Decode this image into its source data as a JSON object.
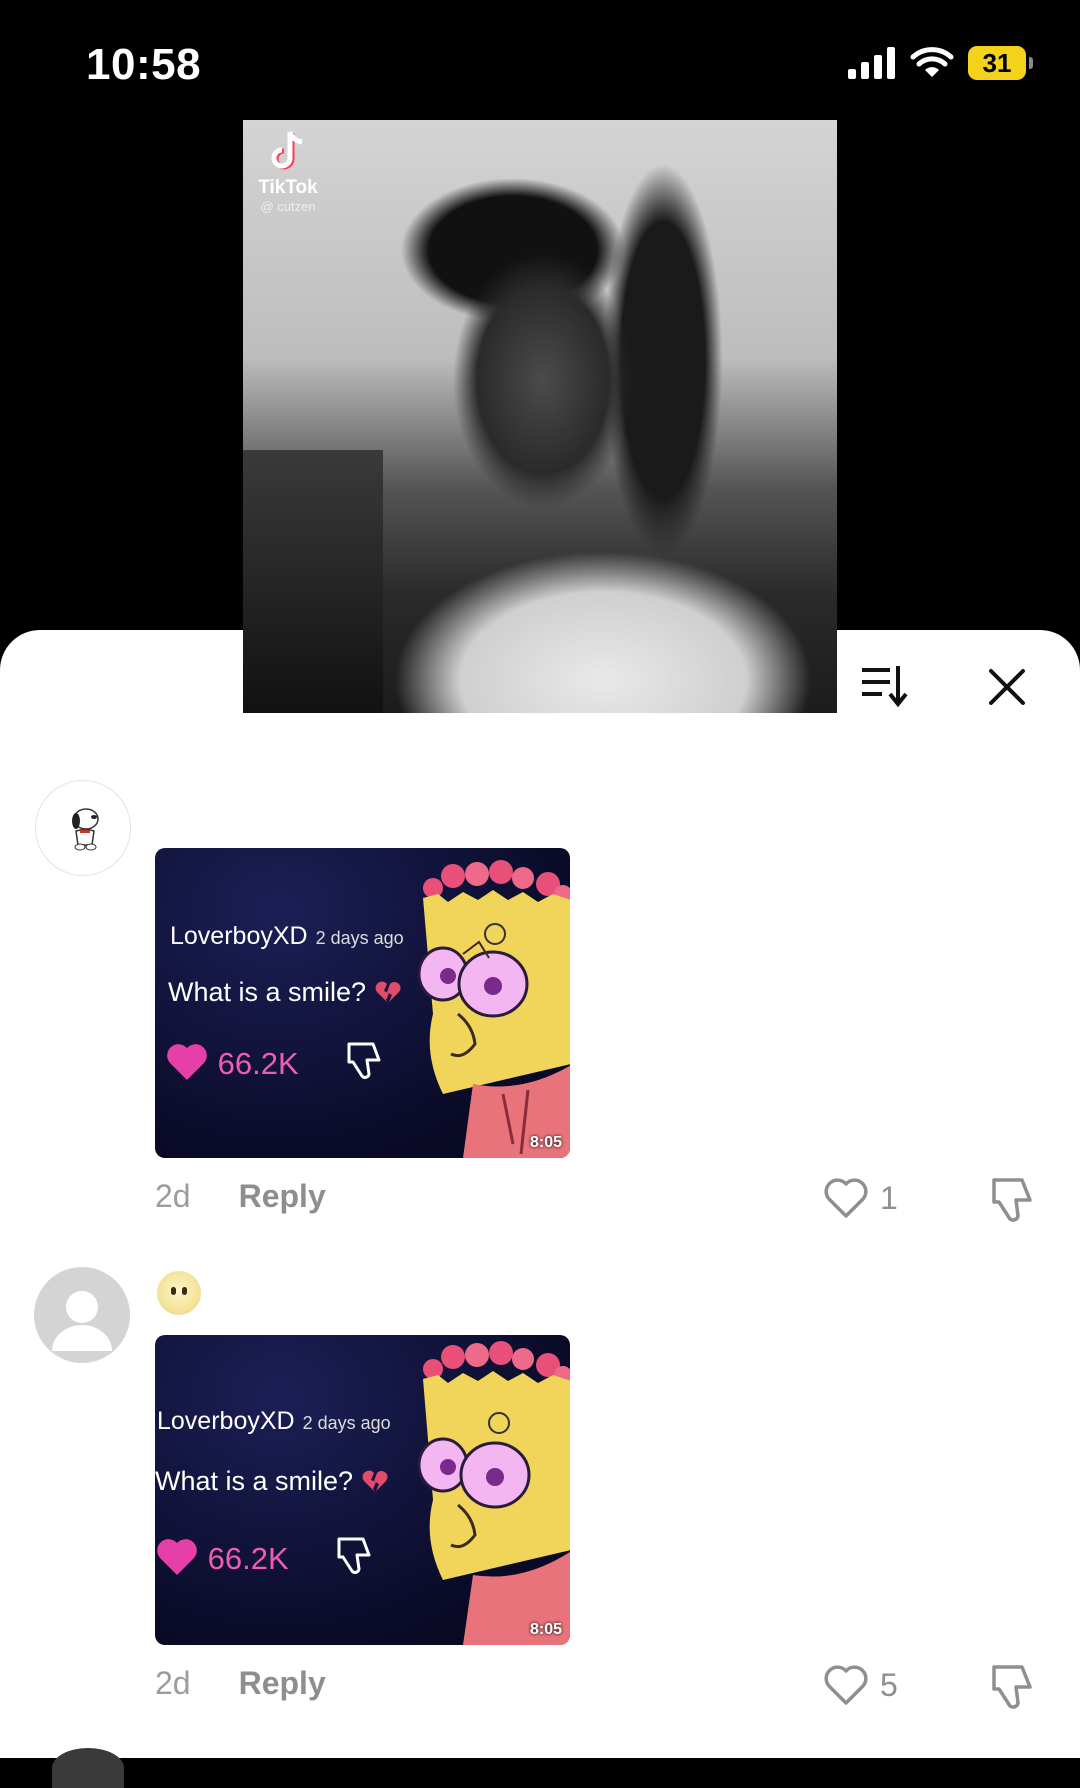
{
  "status_bar": {
    "time": "10:58",
    "battery": "31"
  },
  "video": {
    "watermark_name": "TikTok",
    "watermark_handle": "@ cutzen"
  },
  "comments": [
    {
      "meme": {
        "username": "LoverboyXD",
        "ago": "2 days ago",
        "question": "What is a smile?",
        "likes": "66.2K",
        "duration": "8:05"
      },
      "age": "2d",
      "reply_label": "Reply",
      "like_count": "1"
    },
    {
      "meme": {
        "username": "LoverboyXD",
        "ago": "2 days ago",
        "question": "What is a smile?",
        "likes": "66.2K",
        "duration": "8:05"
      },
      "age": "2d",
      "reply_label": "Reply",
      "like_count": "5"
    }
  ],
  "colors": {
    "accent_pink": "#f05cae",
    "meta_gray": "#9c9c9c",
    "battery_yellow": "#f2d21b"
  }
}
